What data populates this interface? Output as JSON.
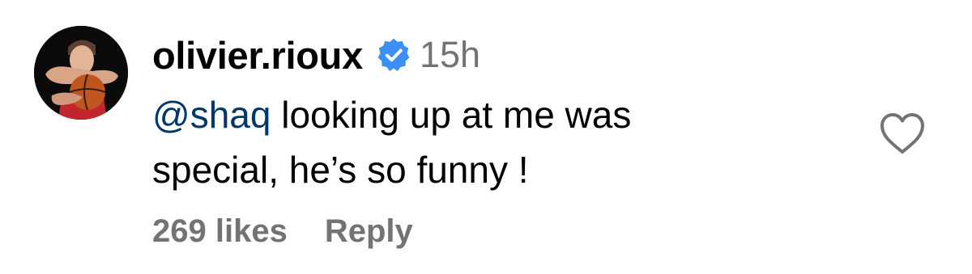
{
  "comment": {
    "username": "olivier.rioux",
    "timestamp": "15h",
    "mention": "@shaq",
    "text_line1": " looking up at me was",
    "text_line2": "special, he’s so funny !",
    "likes_label": "269 likes",
    "reply_label": "Reply"
  },
  "icons": {
    "avatar": "profile-photo",
    "verified": "verified-badge-icon",
    "like": "heart-outline-icon"
  },
  "colors": {
    "text": "#000000",
    "secondary": "#737373",
    "mention": "#00376b",
    "verified": "#3b8ff5",
    "heart": "#737373"
  }
}
